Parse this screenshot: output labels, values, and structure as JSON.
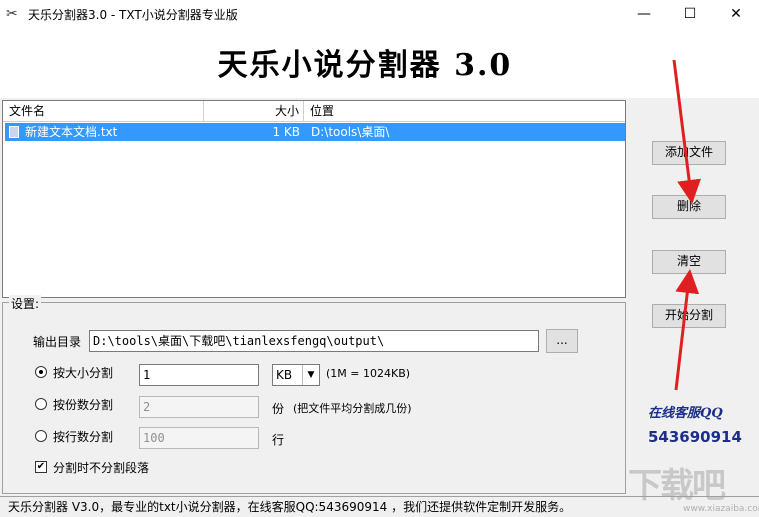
{
  "window": {
    "title": "天乐分割器3.0 - TXT小说分割器专业版",
    "minimize": "—",
    "maximize": "☐",
    "close": "✕"
  },
  "header": {
    "title": "天乐小说分割器 3.0"
  },
  "file_list": {
    "columns": {
      "name": "文件名",
      "size": "大小",
      "location": "位置"
    },
    "rows": [
      {
        "name": "新建文本文档.txt",
        "size": "1 KB",
        "location": "D:\\tools\\桌面\\",
        "icon": "text-file-icon",
        "selected": true
      }
    ],
    "selection_color": "#3399ff"
  },
  "settings": {
    "legend": "设置:",
    "output_dir_label": "输出目录",
    "output_dir_value": "D:\\tools\\桌面\\下载吧\\tianlexsfengq\\output\\",
    "browse_label": "...",
    "split_by_size": {
      "label": "按大小分割",
      "checked": true,
      "value": "1",
      "unit": "KB",
      "hint": "(1M = 1024KB)"
    },
    "split_by_parts": {
      "label": "按份数分割",
      "checked": false,
      "value": "2",
      "unit": "份",
      "hint": "(把文件平均分割成几份)"
    },
    "split_by_lines": {
      "label": "按行数分割",
      "checked": false,
      "value": "100",
      "unit": "行"
    },
    "no_split_paragraph": {
      "label": "分割时不分割段落",
      "checked": true
    }
  },
  "actions": {
    "add_file": "添加文件",
    "delete": "删除",
    "clear": "清空",
    "start_split": "开始分割"
  },
  "support": {
    "label": "在线客服QQ",
    "number": "543690914",
    "color": "#1c2e8a"
  },
  "status_bar": {
    "text": "天乐分割器 V3.0，最专业的txt小说分割器，在线客服QQ:543690914 ，我们还提供软件定制开发服务。"
  },
  "watermark": {
    "text": "下载吧",
    "sub": "www.xiazaiba.com"
  },
  "annotation_color": "#e02020"
}
